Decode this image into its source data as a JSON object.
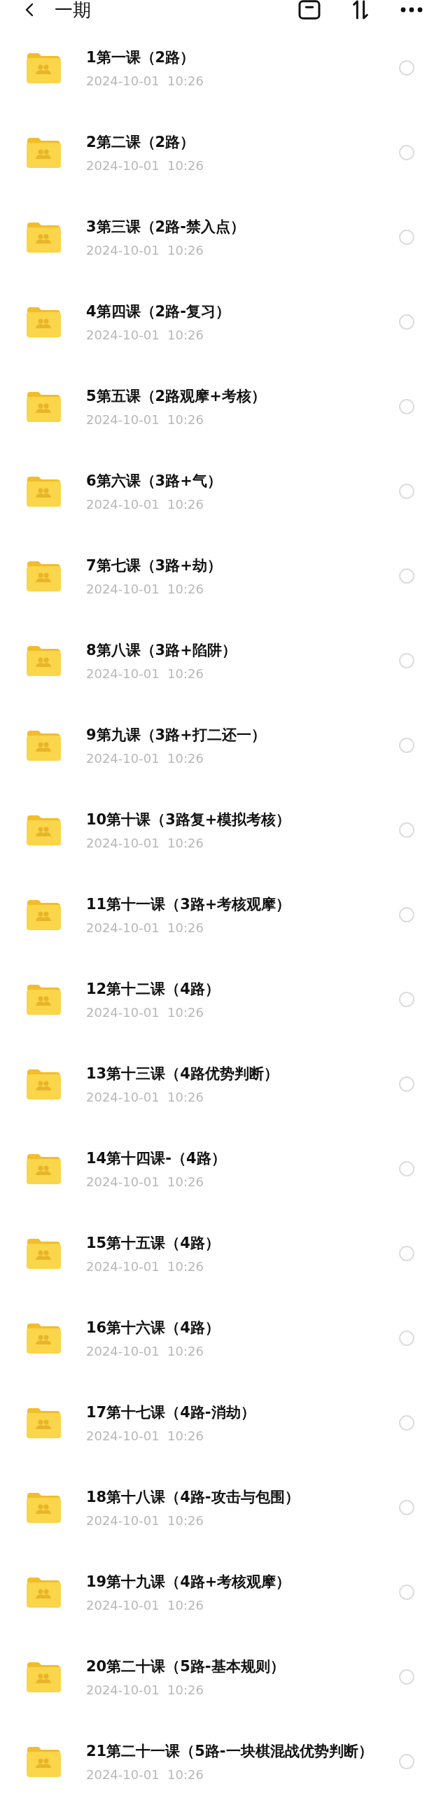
{
  "header": {
    "title": "一期"
  },
  "folders": [
    {
      "name": "1第一课（2路）",
      "date": "2024-10-01  10:26",
      "selected": false
    },
    {
      "name": "2第二课（2路）",
      "date": "2024-10-01  10:26",
      "selected": false
    },
    {
      "name": "3第三课（2路-禁入点）",
      "date": "2024-10-01  10:26",
      "selected": false
    },
    {
      "name": "4第四课（2路-复习）",
      "date": "2024-10-01  10:26",
      "selected": false
    },
    {
      "name": "5第五课（2路观摩+考核）",
      "date": "2024-10-01  10:26",
      "selected": false
    },
    {
      "name": "6第六课（3路+气）",
      "date": "2024-10-01  10:26",
      "selected": false
    },
    {
      "name": "7第七课（3路+劫）",
      "date": "2024-10-01  10:26",
      "selected": false
    },
    {
      "name": "8第八课（3路+陷阱）",
      "date": "2024-10-01  10:26",
      "selected": false
    },
    {
      "name": "9第九课（3路+打二还一）",
      "date": "2024-10-01  10:26",
      "selected": false
    },
    {
      "name": "10第十课（3路复+模拟考核）",
      "date": "2024-10-01  10:26",
      "selected": false
    },
    {
      "name": "11第十一课（3路+考核观摩）",
      "date": "2024-10-01  10:26",
      "selected": false
    },
    {
      "name": "12第十二课（4路）",
      "date": "2024-10-01  10:26",
      "selected": false
    },
    {
      "name": "13第十三课（4路优势判断）",
      "date": "2024-10-01  10:26",
      "selected": false
    },
    {
      "name": "14第十四课-（4路）",
      "date": "2024-10-01  10:26",
      "selected": false
    },
    {
      "name": "15第十五课（4路）",
      "date": "2024-10-01  10:26",
      "selected": false
    },
    {
      "name": "16第十六课（4路）",
      "date": "2024-10-01  10:26",
      "selected": false
    },
    {
      "name": "17第十七课（4路-消劫）",
      "date": "2024-10-01  10:26",
      "selected": false
    },
    {
      "name": "18第十八课（4路-攻击与包围）",
      "date": "2024-10-01  10:26",
      "selected": false
    },
    {
      "name": "19第十九课（4路+考核观摩）",
      "date": "2024-10-01  10:26",
      "selected": false
    },
    {
      "name": "20第二十课（5路-基本规则）",
      "date": "2024-10-01  10:26",
      "selected": false
    },
    {
      "name": "21第二十一课（5路-一块棋混战优势判断）",
      "date": "2024-10-01  10:26",
      "selected": false
    }
  ]
}
